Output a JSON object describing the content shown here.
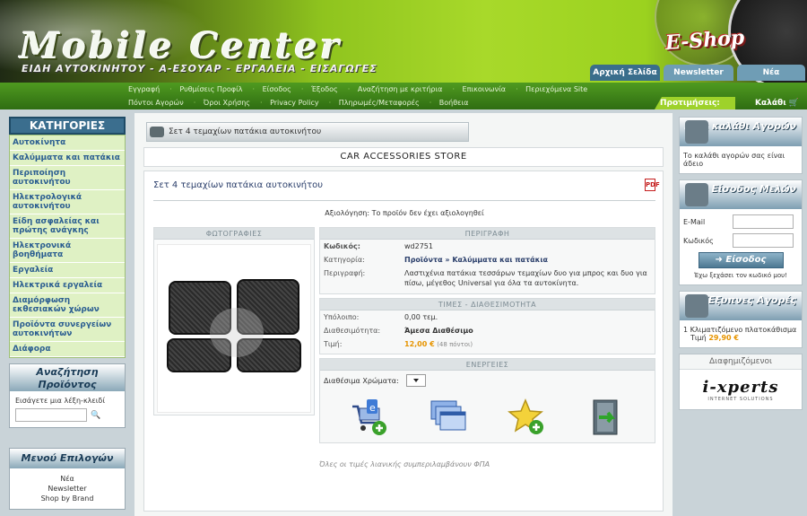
{
  "header": {
    "logo": "Mobile Center",
    "slogan": "ΕΙΔΗ ΑΥΤΟΚΙΝΗΤΟΥ - Α-ΕΣΟΥΑΡ - ΕΡΓΑΛΕΙΑ - ΕΙΣΑΓΩΓΕΣ",
    "eshop": "E-Shop",
    "top_tabs": [
      "Αρχική Σελίδα",
      "Newsletter",
      "Νέα"
    ]
  },
  "menu": {
    "row1": [
      "Εγγραφή",
      "Ρυθμίσεις Προφίλ",
      "Είσοδος",
      "Έξοδος",
      "Αναζήτηση με κριτήρια",
      "Επικοινωνία",
      "Περιεχόμενα Site"
    ],
    "row2": [
      "Πόντοι Αγορών",
      "Όροι Χρήσης",
      "Privacy Policy",
      "Πληρωμές/Μεταφορές",
      "Βοήθεια"
    ],
    "favorites": "Προτιμήσεις:",
    "cart": "Καλάθι"
  },
  "left": {
    "categories_title": "ΚΑΤΗΓΟΡΙΕΣ",
    "categories": [
      "Αυτοκίνητα",
      "Καλύμματα και πατάκια",
      "Περιποίηση αυτοκινήτου",
      "Ηλεκτρολογικά αυτοκινήτου",
      "Είδη ασφαλείας και πρώτης ανάγκης",
      "Ηλεκτρονικά βοηθήματα",
      "Εργαλεία",
      "Ηλεκτρικά εργαλεία",
      "Διαμόρφωση εκθεσιακών χώρων",
      "Προϊόντα συνεργείων αυτοκινήτων",
      "Διάφορα"
    ],
    "search_title": "Αναζήτηση Προϊόντος",
    "search_hint": "Εισάγετε μια λέξη-κλειδί",
    "menu_title": "Μενού Επιλογών",
    "menu_links": [
      "Νέα",
      "Newsletter",
      "Shop by Brand"
    ]
  },
  "center": {
    "breadcrumb": "Σετ 4 τεμαχίων πατάκια αυτοκινήτου",
    "store_title": "CAR ACCESSORIES STORE",
    "product_title": "Σετ 4 τεμαχίων πατάκια αυτοκινήτου",
    "pdf_label": "PDF",
    "rating_label": "Αξιολόγηση:",
    "rating_value": "Το προϊόν δεν έχει αξιολογηθεί",
    "photos_head": "ΦΩΤΟΓΡΑΦΙΕΣ",
    "description_head": "ΠΕΡΙΓΡΑΦΗ",
    "code_label": "Κωδικός:",
    "code_value": "wd2751",
    "category_label": "Κατηγορία:",
    "category_value": "Προϊόντα » Καλύμματα και πατάκια",
    "desc_label": "Περιγραφή:",
    "desc_value": "Λαστιχένια πατάκια τεσσάρων τεμαχίων δυο για μπρος και δυο για πίσω, μέγεθος Universal για όλα τα αυτοκίνητα.",
    "prices_head": "ΤΙΜΕΣ - ΔΙΑΘΕΣΙΜΟΤΗΤΑ",
    "stock_label": "Υπόλοιπο:",
    "stock_value": "0,00 τεμ.",
    "avail_label": "Διαθεσιμότητα:",
    "avail_value": "Άμεσα Διαθέσιμο",
    "price_label": "Τιμή:",
    "price_value": "12,00 €",
    "points_value": "(48 πόντοι)",
    "actions_head": "ΕΝΕΡΓΕΙΕΣ",
    "colors_label": "Διαθέσιμα Χρώματα:",
    "vat_note": "Όλες οι τιμές λιανικής συμπεριλαμβάνουν ΦΠΑ"
  },
  "right": {
    "mini_cart_title": "Μίνι καλάθι Αγορών",
    "mini_cart_text": "Το καλάθι αγορών σας είναι άδειο",
    "login_title": "Είσοδος Μελών",
    "email_label": "E-Mail",
    "password_label": "Κωδικός",
    "login_button": "Είσοδος",
    "forgot": "Έχω ξεχάσει τον κωδικό μου!",
    "best_title": "Έξυπνες Αγορές",
    "best_item": "1 Κλιματιζόμενο πλατοκάθισμα",
    "best_price_label": "Τιμή",
    "best_price": "29,90 €",
    "ads_title": "Διαφημιζόμενοι",
    "ad_brand": "i-xperts",
    "ad_sub": "INTERNET SOLUTIONS"
  },
  "colors": {
    "accent_green": "#8fc41e",
    "nav_blue": "#3a6e8c",
    "category_link": "#2b5e91",
    "price_orange": "#e69400",
    "available_green": "#3b9a1d"
  }
}
